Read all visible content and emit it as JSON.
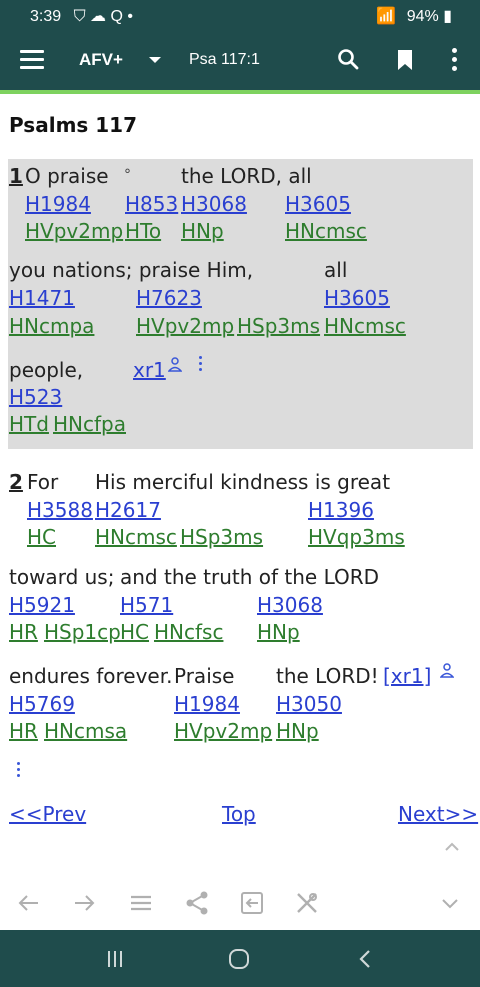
{
  "status_bar": {
    "time": "3:39",
    "left_icons": "⛉ ☁ Q •",
    "battery": "94%"
  },
  "app_bar": {
    "bible_name": "AFV+",
    "reference": "Psa 117:1"
  },
  "chapter_title": "Psalms 117",
  "verses": [
    {
      "number": "1",
      "lines": [
        {
          "words": [
            "O praise",
            "°",
            "the LORD, all"
          ],
          "strongs": [
            "H1984",
            "H853",
            "H3068",
            "H3605"
          ],
          "morph": [
            "HVpv2mp",
            "HTo",
            "HNp",
            "HNcmsc"
          ]
        },
        {
          "words": [
            "you nations; praise Him,",
            "all"
          ],
          "strongs": [
            "H1471",
            "H7623",
            "H3605"
          ],
          "morph": [
            "HNcmpa",
            "HVpv2mp",
            "HSp3ms",
            "HNcmsc"
          ]
        },
        {
          "words": [
            "people,"
          ],
          "strongs": [
            "H523"
          ],
          "morph": [
            "HTd",
            "HNcfpa"
          ],
          "xref": "xr1"
        }
      ]
    },
    {
      "number": "2",
      "lines": [
        {
          "words": [
            "For",
            "His merciful kindness is great"
          ],
          "strongs": [
            "H3588",
            "H2617",
            "H1396"
          ],
          "morph": [
            "HC",
            "HNcmsc",
            "HSp3ms",
            "HVqp3ms"
          ]
        },
        {
          "words": [
            "toward us;",
            "and the truth of the LORD"
          ],
          "strongs": [
            "H5921",
            "H571",
            "H3068"
          ],
          "morph": [
            "HR",
            "HSp1cp",
            "HC",
            "HNcfsc",
            "HNp"
          ]
        },
        {
          "words": [
            "endures forever.",
            "Praise",
            "the LORD!"
          ],
          "strongs": [
            "H5769",
            "H1984",
            "H3050"
          ],
          "morph": [
            "HR",
            "HNcmsa",
            "HVpv2mp",
            "HNp"
          ],
          "xref": "[xr1]"
        }
      ]
    }
  ],
  "nav": {
    "prev": "<<Prev",
    "top": "Top",
    "next": "Next>>"
  },
  "icons": [
    "menu-icon",
    "dropdown-caret-icon",
    "search-icon",
    "bookmark-icon",
    "more-vert-icon",
    "person-icon",
    "back-arrow-icon",
    "forward-arrow-icon",
    "list-icon",
    "share-icon",
    "exit-icon",
    "tools-icon",
    "chevron-down-icon",
    "chevron-up-icon"
  ],
  "colors": {
    "appbar": "#1f4c4c",
    "accent_line": "#7ed25f",
    "strongs_link": "#2a3fd0",
    "morph_link": "#2e7d2e",
    "highlight": "#dcdcdc"
  }
}
